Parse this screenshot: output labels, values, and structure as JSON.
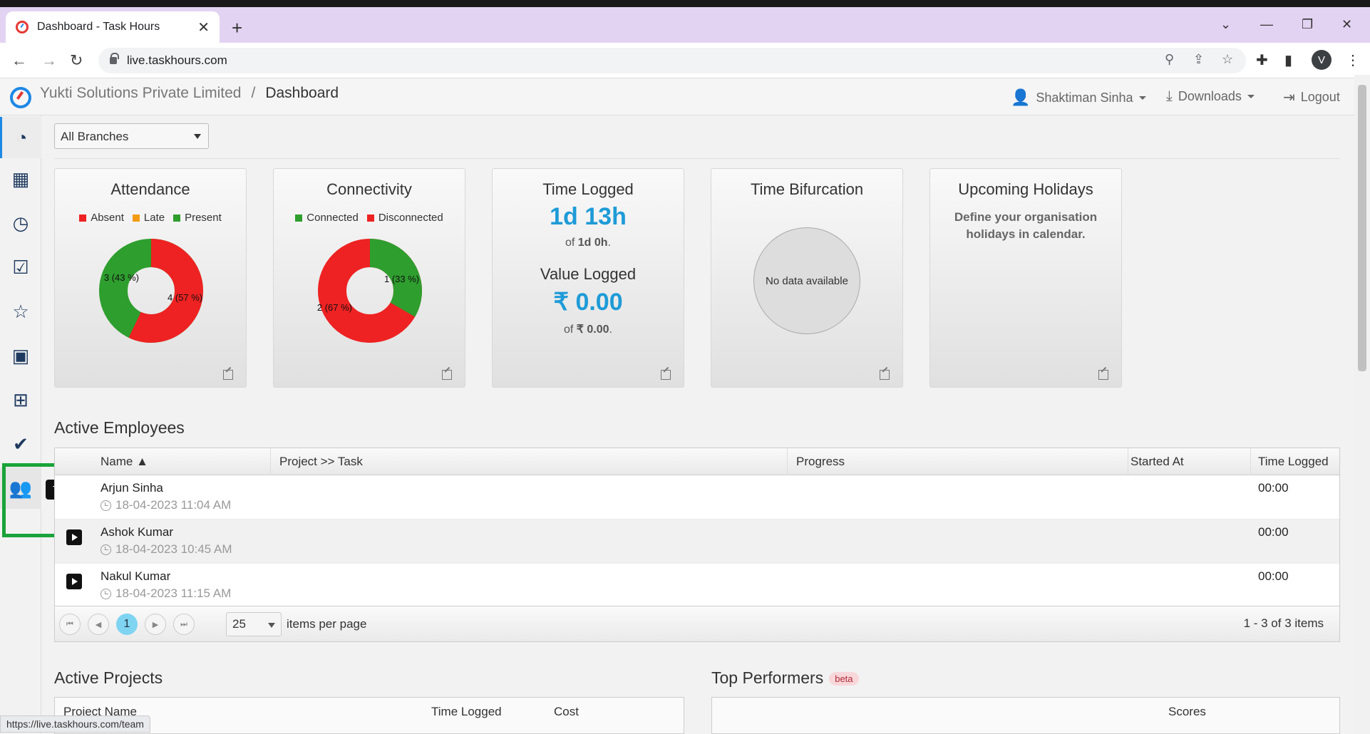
{
  "browser": {
    "tab_title": "Dashboard - Task Hours",
    "url": "live.taskhours.com",
    "profile_initial": "V",
    "status_url": "https://live.taskhours.com/team"
  },
  "header": {
    "org": "Yukti Solutions Private Limited",
    "separator": "/",
    "page": "Dashboard",
    "user": "Shaktiman Sinha",
    "downloads": "Downloads",
    "logout": "Logout"
  },
  "sidebar": {
    "items": [
      "dashboard-icon",
      "calendar-icon",
      "clock-icon",
      "clipboard-check-icon",
      "star-icon",
      "contact-card-icon",
      "grid-icon",
      "checklist-icon",
      "team-icon"
    ],
    "tooltip": "Team"
  },
  "filter": {
    "branch": "All Branches"
  },
  "cards": {
    "attendance": {
      "title": "Attendance",
      "legend": [
        "Absent",
        "Late",
        "Present"
      ],
      "colors": {
        "absent": "#ee2222",
        "late": "#f39c12",
        "present": "#2e9e2e"
      },
      "slices": [
        {
          "label": "4 (57 %)",
          "value": 4
        },
        {
          "label": "3 (43 %)",
          "value": 3
        }
      ]
    },
    "connectivity": {
      "title": "Connectivity",
      "legend": [
        "Connected",
        "Disconnected"
      ],
      "slices": [
        {
          "label": "1 (33 %)",
          "value": 1
        },
        {
          "label": "2 (67 %)",
          "value": 2
        }
      ]
    },
    "time_logged": {
      "title": "Time Logged",
      "value": "1d 13h",
      "of_prefix": "of",
      "of_value": "1d 0h",
      "value_title": "Value Logged",
      "amount": "₹ 0.00",
      "amount_of": "₹ 0.00"
    },
    "bifurcation": {
      "title": "Time Bifurcation",
      "nodata": "No data available"
    },
    "holidays": {
      "title": "Upcoming Holidays",
      "text": "Define your organisation holidays in calendar."
    }
  },
  "employees": {
    "title": "Active Employees",
    "columns": [
      "Name ▲",
      "Project >> Task",
      "Progress",
      "Started At",
      "Time Logged"
    ],
    "rows": [
      {
        "name": "Arjun Sinha",
        "time": "18-04-2023 11:04 AM",
        "logged": "00:00"
      },
      {
        "name": "Ashok Kumar",
        "time": "18-04-2023 10:45 AM",
        "logged": "00:00"
      },
      {
        "name": "Nakul Kumar",
        "time": "18-04-2023 11:15 AM",
        "logged": "00:00"
      }
    ],
    "page": "1",
    "page_size": "25",
    "per_page_label": "items per page",
    "info": "1 - 3 of 3 items"
  },
  "projects": {
    "title": "Active Projects",
    "columns": [
      "Project Name",
      "Time Logged",
      "Cost"
    ]
  },
  "performers": {
    "title": "Top Performers",
    "badge": "beta",
    "scores": "Scores"
  }
}
